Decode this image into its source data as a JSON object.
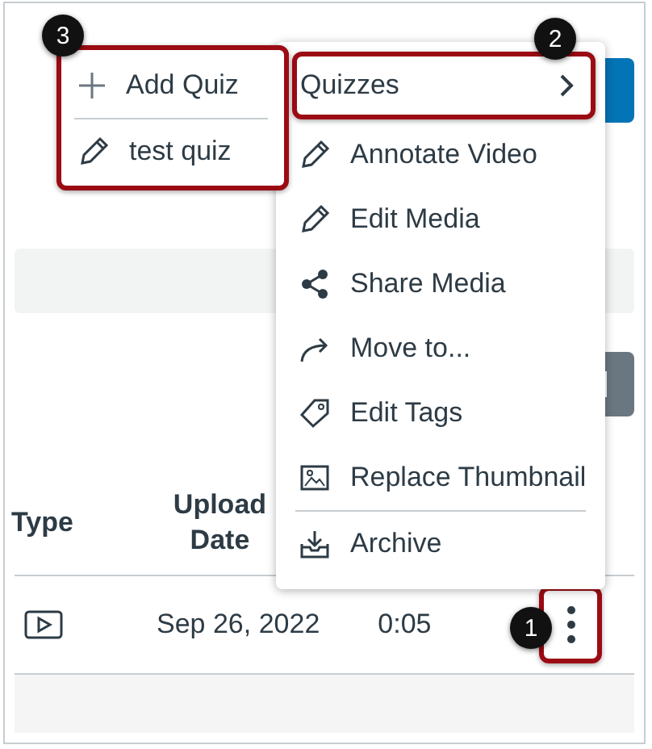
{
  "table": {
    "columns": [
      "Type",
      "Upload\nDate"
    ],
    "rows": [
      {
        "kind": "video",
        "date": "Sep 26, 2022",
        "duration": "0:05",
        "callout": "1"
      }
    ]
  },
  "menu": {
    "items": [
      {
        "label": "Quizzes",
        "kind": "submenu",
        "divider_before": false,
        "callout": "2"
      },
      {
        "label": "Annotate Video",
        "kind": "pencil",
        "divider_before": false
      },
      {
        "label": "Edit Media",
        "kind": "pencil",
        "divider_before": false
      },
      {
        "label": "Share Media",
        "kind": "share",
        "divider_before": false
      },
      {
        "label": "Move to...",
        "kind": "move",
        "divider_before": false
      },
      {
        "label": "Edit Tags",
        "kind": "tag",
        "divider_before": false
      },
      {
        "label": "Replace Thumbnail",
        "kind": "image",
        "divider_before": false
      },
      {
        "label": "Archive",
        "kind": "archive",
        "divider_before": true
      }
    ]
  },
  "submenu": {
    "callout": "3",
    "items": [
      {
        "label": "Add Quiz",
        "kind": "add"
      },
      {
        "label": "test quiz",
        "kind": "pencil"
      }
    ]
  }
}
